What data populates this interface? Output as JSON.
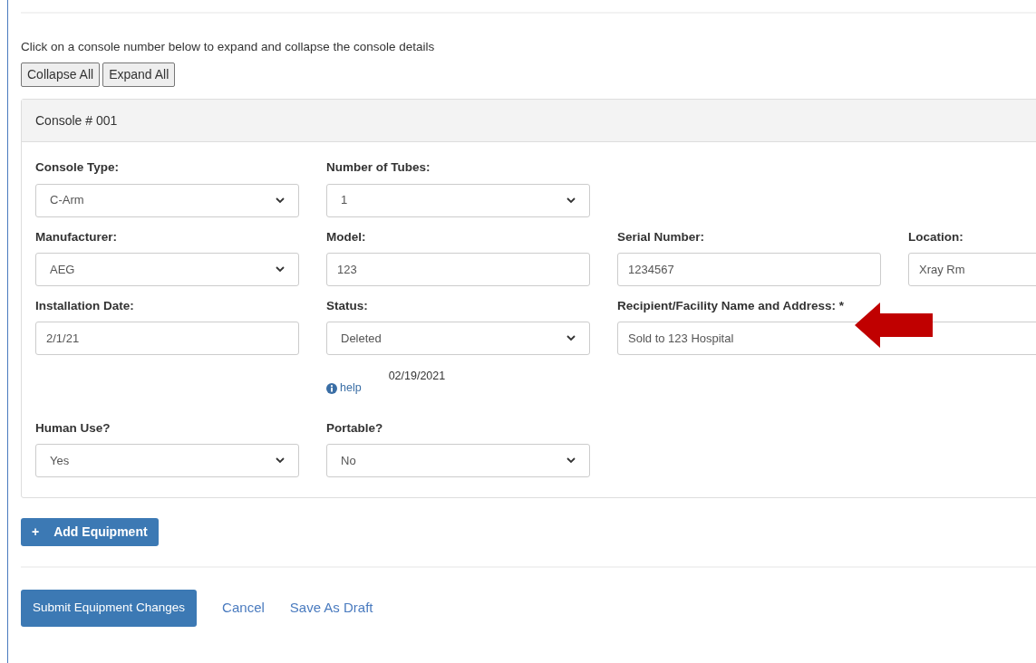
{
  "instructions": "Click on a console number below to expand and collapse the console details",
  "toggle_buttons": [
    "Collapse All",
    "Expand All"
  ],
  "console": {
    "title": "Console # 001",
    "rows": [
      [
        {
          "kind": "select",
          "label": "Console Type:",
          "value": "C-Arm"
        },
        {
          "kind": "select",
          "label": "Number of Tubes:",
          "value": "1"
        }
      ],
      [
        {
          "kind": "select",
          "label": "Manufacturer:",
          "value": "AEG"
        },
        {
          "kind": "text",
          "label": "Model:",
          "value": "123"
        },
        {
          "kind": "text",
          "label": "Serial Number:",
          "value": "1234567"
        },
        {
          "kind": "text",
          "label": "Location:",
          "value": "Xray Rm"
        }
      ],
      [
        {
          "kind": "text",
          "label": "Installation Date:",
          "value": "2/1/21"
        },
        {
          "kind": "select",
          "label": "Status:",
          "value": "Deleted",
          "help": "help",
          "date": "02/19/2021"
        },
        {
          "kind": "wide-text",
          "label": "Recipient/Facility Name and Address: *",
          "value": "Sold to 123 Hospital"
        }
      ],
      [
        {
          "kind": "select",
          "label": "Human Use?",
          "value": "Yes"
        },
        {
          "kind": "select",
          "label": "Portable?",
          "value": "No"
        }
      ]
    ]
  },
  "add_button": {
    "icon": "+",
    "label": "Add Equipment"
  },
  "actions": {
    "submit": "Submit Equipment Changes",
    "links": [
      "Cancel",
      "Save As Draft"
    ]
  }
}
